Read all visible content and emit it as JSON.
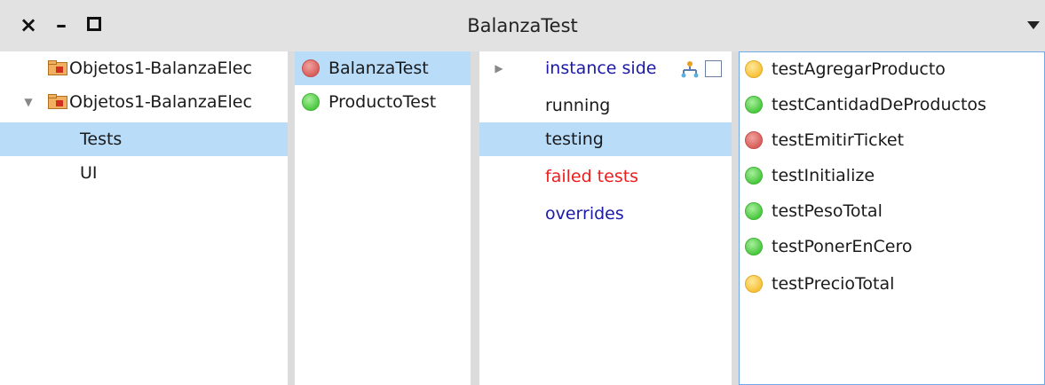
{
  "window": {
    "title": "BalanzaTest",
    "close_glyph": "×",
    "minimize_glyph": "–"
  },
  "packages": {
    "items": [
      {
        "label": "Objetos1-BalanzaElec",
        "expanded": false,
        "selected": false
      },
      {
        "label": "Objetos1-BalanzaElec",
        "expanded": true,
        "selected": false
      },
      {
        "label": "Tests",
        "selected": true
      },
      {
        "label": "UI",
        "selected": false
      }
    ]
  },
  "classes": {
    "items": [
      {
        "label": "BalanzaTest",
        "status": "red",
        "selected": true
      },
      {
        "label": "ProductoTest",
        "status": "green",
        "selected": false
      }
    ]
  },
  "protocols": {
    "instance_side": "instance side",
    "items": [
      {
        "label": "running",
        "selected": false
      },
      {
        "label": "testing",
        "selected": true
      },
      {
        "label": "failed tests",
        "selected": false
      },
      {
        "label": "overrides",
        "selected": false
      }
    ]
  },
  "methods": {
    "items": [
      {
        "label": "testAgregarProducto",
        "status": "yellow"
      },
      {
        "label": "testCantidadDeProductos",
        "status": "green"
      },
      {
        "label": "testEmitirTicket",
        "status": "red"
      },
      {
        "label": "testInitialize",
        "status": "green"
      },
      {
        "label": "testPesoTotal",
        "status": "green"
      },
      {
        "label": "testPonerEnCero",
        "status": "green"
      },
      {
        "label": "testPrecioTotal",
        "status": "yellow"
      }
    ]
  },
  "colors": {
    "selection": "#b9dcf9",
    "test_pass": "#4cc940",
    "test_fail": "#d8605c",
    "test_warn": "#f7c23a",
    "protocol_blue": "#1a1aa6",
    "failed_red": "#ee1c1c"
  },
  "icons": {
    "package": "package-icon",
    "expand": "expand-triangle-icon",
    "collapse": "collapse-triangle-icon",
    "hierarchy": "hierarchy-icon",
    "checkbox": "checkbox-icon"
  }
}
